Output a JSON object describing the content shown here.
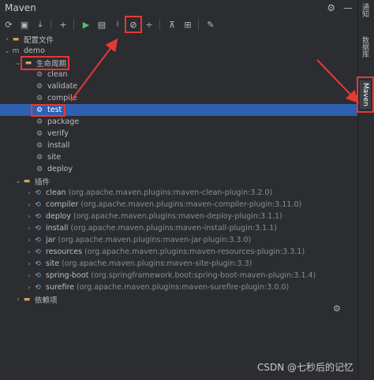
{
  "panel": {
    "title": "Maven",
    "header_icons": [
      "gear-icon",
      "minimize-icon"
    ]
  },
  "toolbar": {
    "buttons": [
      {
        "name": "refresh-icon",
        "glyph": "⟳"
      },
      {
        "name": "reimport-icon",
        "glyph": "▣"
      },
      {
        "name": "download-icon",
        "glyph": "⤓"
      },
      {
        "name": "add-icon",
        "glyph": "+"
      },
      {
        "name": "run-icon",
        "glyph": "▶"
      },
      {
        "name": "run-config-icon",
        "glyph": "▤"
      },
      {
        "name": "toggle-offline-icon",
        "glyph": "⟊"
      },
      {
        "name": "skip-tests-icon",
        "glyph": "⊘"
      },
      {
        "name": "collapse-icon",
        "glyph": "÷"
      },
      {
        "name": "diagram-icon",
        "glyph": "⊼"
      },
      {
        "name": "show-dependencies-icon",
        "glyph": "⊞"
      },
      {
        "name": "settings-wrench-icon",
        "glyph": "✎"
      }
    ]
  },
  "tree": {
    "config_files": "配置文件",
    "project": "demo",
    "lifecycle": {
      "label": "生命周期",
      "items": [
        "clean",
        "validate",
        "compile",
        "test",
        "package",
        "verify",
        "install",
        "site",
        "deploy"
      ]
    },
    "plugins": {
      "label": "插件",
      "items": [
        {
          "name": "clean",
          "detail": "(org.apache.maven.plugins:maven-clean-plugin:3.2.0)"
        },
        {
          "name": "compiler",
          "detail": "(org.apache.maven.plugins:maven-compiler-plugin:3.11.0)"
        },
        {
          "name": "deploy",
          "detail": "(org.apache.maven.plugins:maven-deploy-plugin:3.1.1)"
        },
        {
          "name": "install",
          "detail": "(org.apache.maven.plugins:maven-install-plugin:3.1.1)"
        },
        {
          "name": "jar",
          "detail": "(org.apache.maven.plugins:maven-jar-plugin:3.3.0)"
        },
        {
          "name": "resources",
          "detail": "(org.apache.maven.plugins:maven-resources-plugin:3.3.1)"
        },
        {
          "name": "site",
          "detail": "(org.apache.maven.plugins:maven-site-plugin:3.3)"
        },
        {
          "name": "spring-boot",
          "detail": "(org.springframework.boot:spring-boot-maven-plugin:3.1.4)"
        },
        {
          "name": "surefire",
          "detail": "(org.apache.maven.plugins:maven-surefire-plugin:3.0.0)"
        }
      ]
    },
    "dependencies": "依赖项"
  },
  "right_bar": {
    "tabs": [
      "通知",
      "数据库",
      "Maven"
    ]
  },
  "watermark": "CSDN @七秒后的记忆",
  "colors": {
    "background": "#2b2d30",
    "selection": "#2f5fb0",
    "annotation": "#e53935",
    "run": "#4fc06a"
  }
}
